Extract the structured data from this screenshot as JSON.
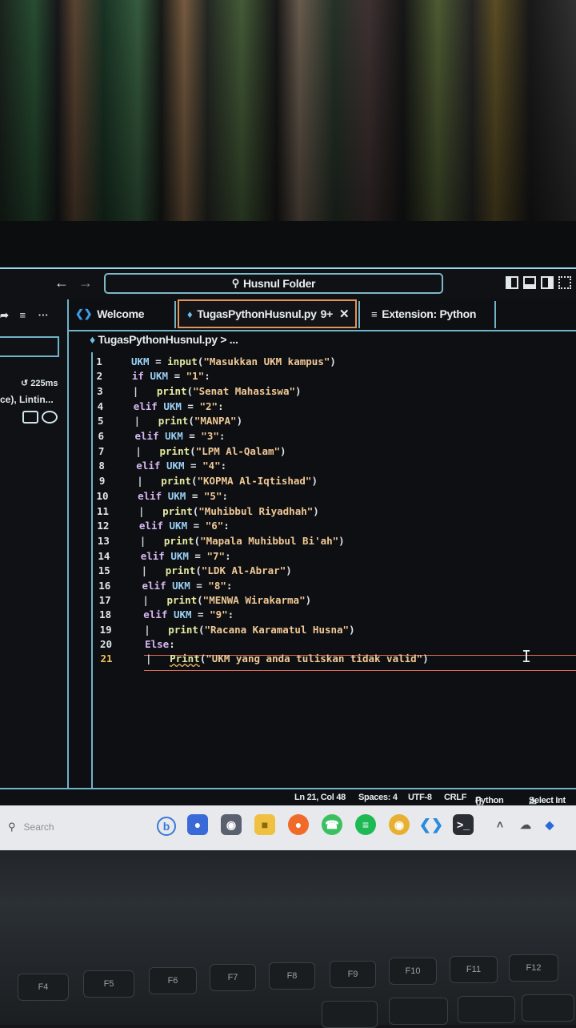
{
  "window": {
    "search_text": "Husnul Folder",
    "nav_back": "←",
    "nav_forward": "→"
  },
  "sidebar": {
    "time": "225ms",
    "extension_text": "ce), Lintin..."
  },
  "tabs": [
    {
      "label": "Welcome",
      "icon": "vscode-icon"
    },
    {
      "label": "TugasPythonHusnul.py",
      "badge": "9+",
      "icon": "python-file-icon",
      "active": true
    },
    {
      "label": "Extension: Python",
      "icon": "extension-icon"
    }
  ],
  "breadcrumb": "TugasPythonHusnul.py > ...",
  "code_lines": [
    {
      "n": "1",
      "text": "UKM = input(\"Masukkan UKM kampus\")"
    },
    {
      "n": "2",
      "text": "if UKM = \"1\":"
    },
    {
      "n": "3",
      "text": "print(\"Senat Mahasiswa\")"
    },
    {
      "n": "4",
      "text": "elif UKM = \"2\":"
    },
    {
      "n": "5",
      "text": "print(\"MANPA\")"
    },
    {
      "n": "6",
      "text": "elif UKM = \"3\":"
    },
    {
      "n": "7",
      "text": "print(\"LPM Al-Qalam\")"
    },
    {
      "n": "8",
      "text": "elif UKM = \"4\":"
    },
    {
      "n": "9",
      "text": "print(\"KOPMA Al-Iqtishad\")"
    },
    {
      "n": "10",
      "text": "elif UKM = \"5\":"
    },
    {
      "n": "11",
      "text": "print(\"Muhibbul Riyadhah\")"
    },
    {
      "n": "12",
      "text": "elif UKM = \"6\":"
    },
    {
      "n": "13",
      "text": "print(\"Mapala Muhibbul Bi'ah\")"
    },
    {
      "n": "14",
      "text": "elif UKM = \"7\":"
    },
    {
      "n": "15",
      "text": "print(\"LDK Al-Abrar\")"
    },
    {
      "n": "16",
      "text": "elif UKM = \"8\":"
    },
    {
      "n": "17",
      "text": "print(\"MENWA Wirakarma\")"
    },
    {
      "n": "18",
      "text": "elif UKM = \"9\":"
    },
    {
      "n": "19",
      "text": "print(\"Racana Karamatul Husna\")"
    },
    {
      "n": "20",
      "text": "Else:"
    },
    {
      "n": "21",
      "text": "Print(\"UKM yang anda tuliskan tidak valid\")"
    }
  ],
  "status": {
    "position": "Ln 21, Col 48",
    "spaces": "Spaces: 4",
    "encoding": "UTF-8",
    "eol": "CRLF",
    "language": "Python",
    "select": "Select Int"
  },
  "taskbar": {
    "search_placeholder": "Search"
  },
  "keyboard": {
    "f4": "F4",
    "f5": "F5",
    "f6": "F6",
    "f7": "F7",
    "f8": "F8",
    "f9": "F9",
    "f10": "F10",
    "f11": "F11",
    "f12": "F12"
  },
  "colors": {
    "accent_border": "#6fb4c8",
    "active_tab_border": "#e6935a",
    "keyword": "#d7b8f3",
    "string": "#f0c896",
    "function": "#e6eaa0",
    "variable": "#9ad0f5"
  }
}
